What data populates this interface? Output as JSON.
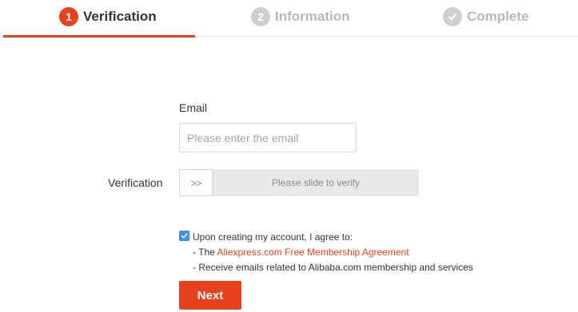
{
  "steps": [
    {
      "number": "1",
      "label": "Verification",
      "state": "active"
    },
    {
      "number": "2",
      "label": "Information",
      "state": "inactive"
    },
    {
      "number": "",
      "label": "Complete",
      "state": "inactive"
    }
  ],
  "colors": {
    "accent": "#e8411d",
    "inactive": "#cfcfcf",
    "checkbox": "#3b8fe8"
  },
  "form": {
    "email_label": "Email",
    "email_placeholder": "Please enter the email",
    "email_value": "",
    "verification_label": "Verification",
    "slider_text": "Please slide to verify",
    "slider_handle": ">>"
  },
  "agreement": {
    "checked": true,
    "intro": "Upon creating my account, I agree to:",
    "line1_prefix": "- The ",
    "line1_link": "Aliexpress.com Free Membership Agreement",
    "line2": "- Receive emails related to Alibaba.com membership and services"
  },
  "buttons": {
    "next": "Next"
  }
}
